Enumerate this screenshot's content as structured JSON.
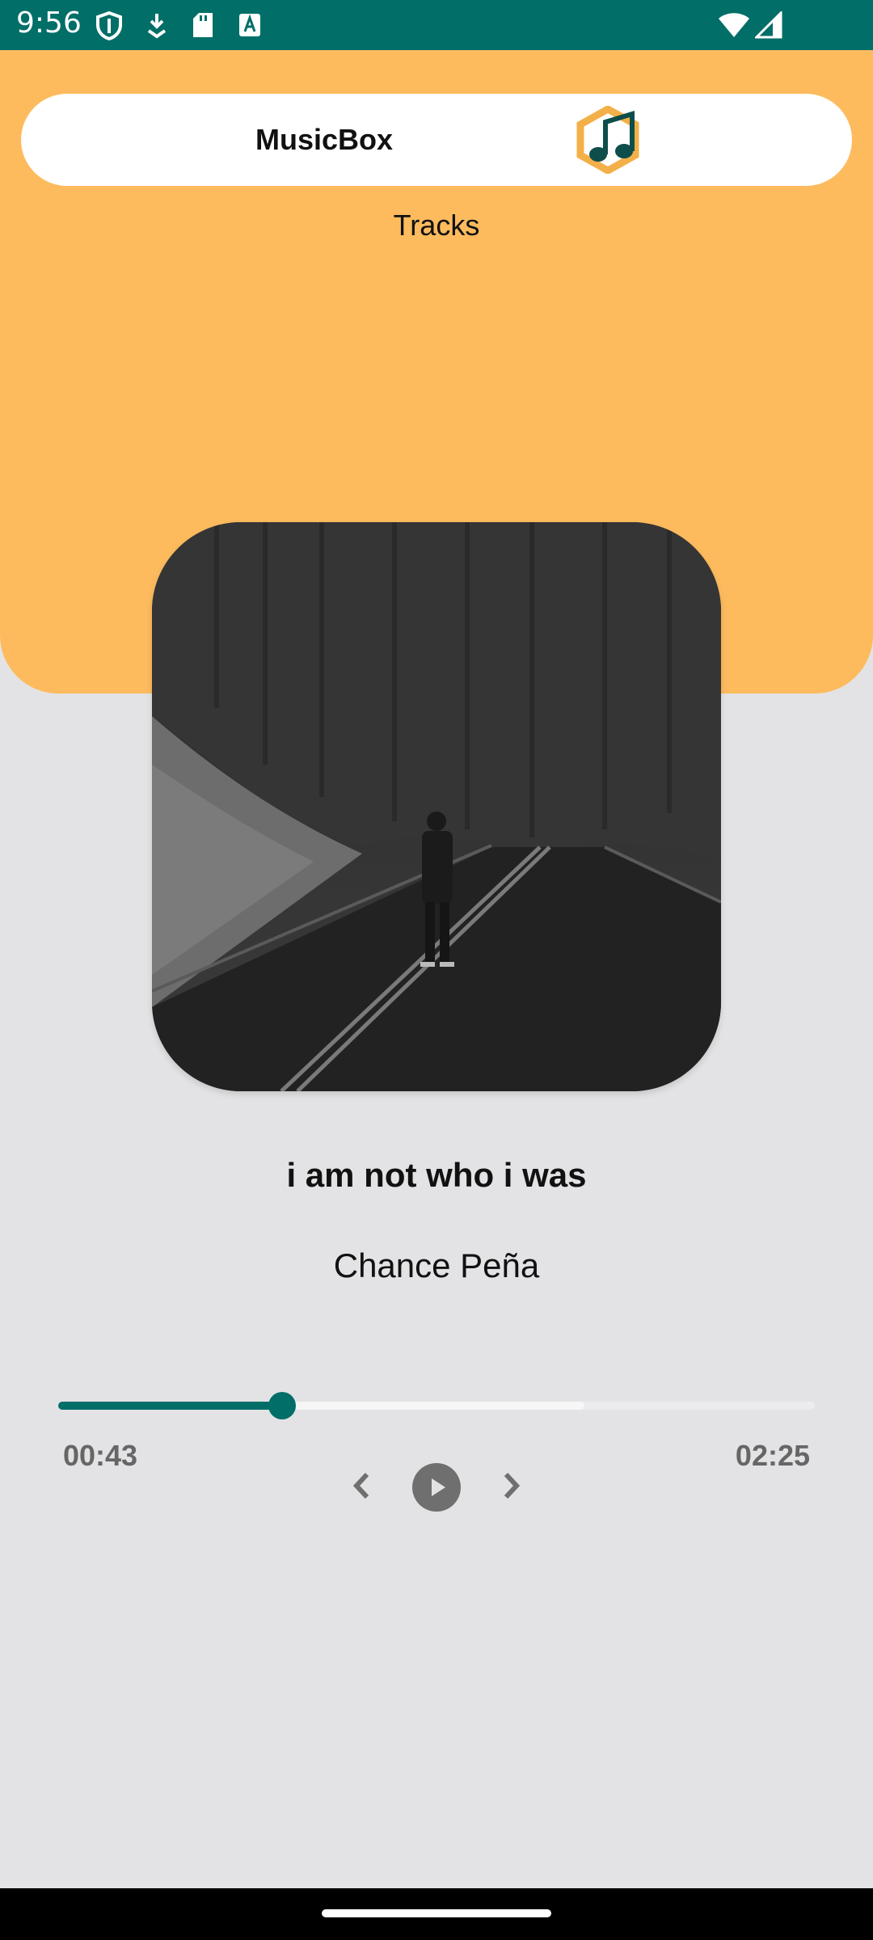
{
  "status_bar": {
    "time": "9:56",
    "icons": [
      "shield-icon",
      "download-icon",
      "sd-card-icon",
      "keyboard-a-icon",
      "wifi-icon",
      "signal-icon"
    ],
    "color": "#016e68"
  },
  "header": {
    "app_name": "MusicBox",
    "logo_icon": "music-note-logo-icon",
    "subtitle": "Tracks",
    "background_color": "#fdbb5e"
  },
  "player": {
    "album_art": "album-cover-person-on-road",
    "track_title": "i am not who i was",
    "artist": "Chance Peña",
    "current_time": "00:43",
    "total_time": "02:25",
    "progress": 0.296,
    "buffered": 0.696,
    "accent_color": "#016e68",
    "controls": {
      "previous_icon": "chevron-left-icon",
      "play_icon": "play-icon",
      "next_icon": "chevron-right-icon"
    }
  }
}
